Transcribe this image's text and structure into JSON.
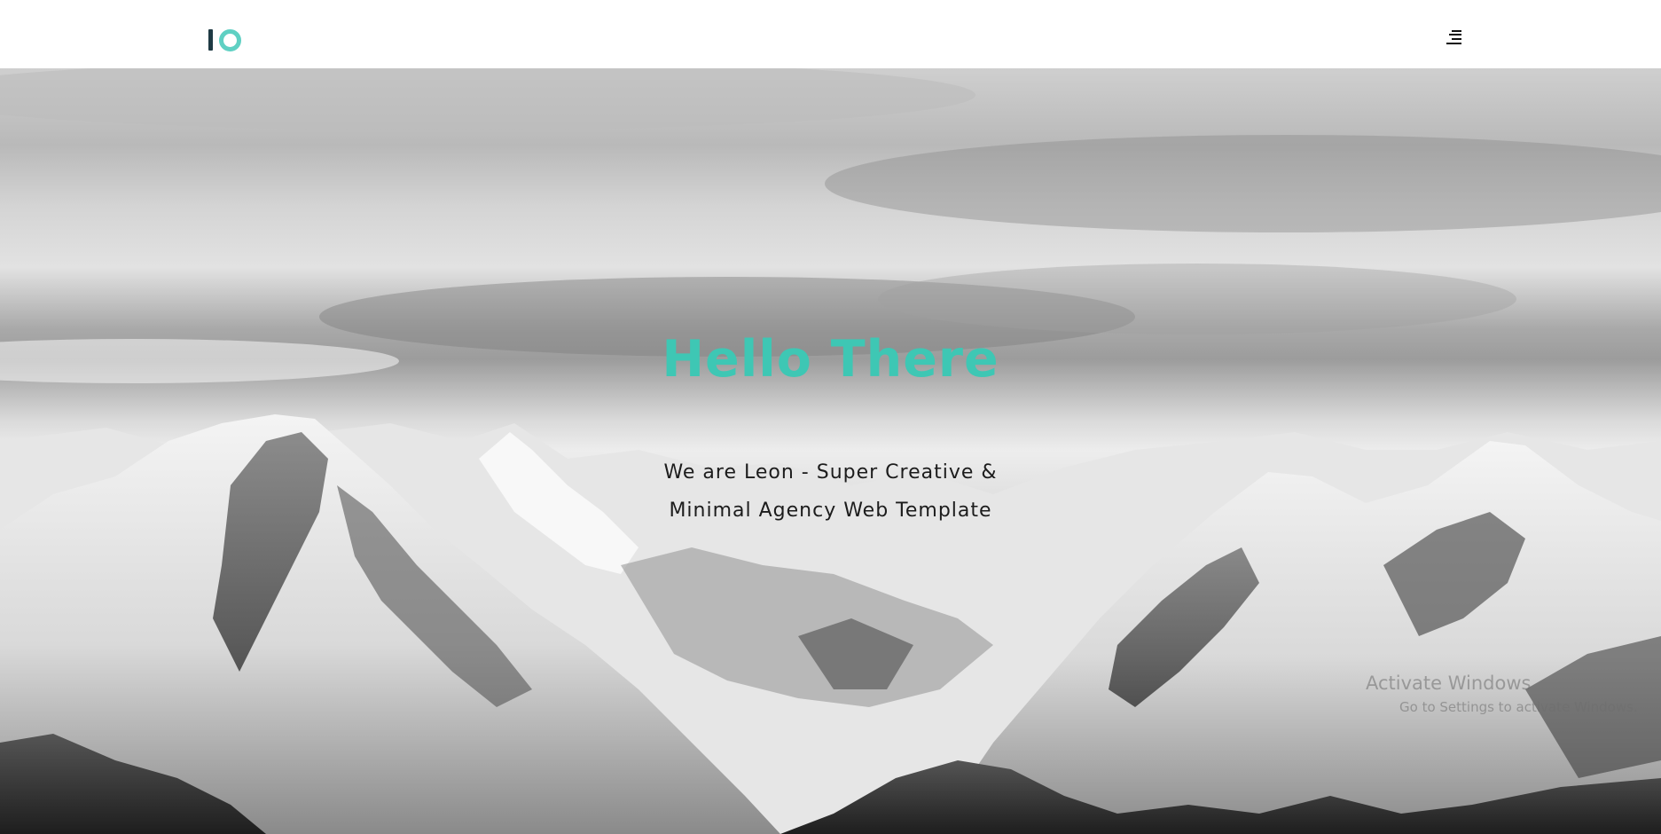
{
  "header": {
    "logo_icon": "io-logo-icon",
    "menu_icon": "hamburger-menu-icon"
  },
  "hero": {
    "title": "Hello There",
    "subtitle_line1": "We are Leon - Super Creative &",
    "subtitle_line2": "Minimal Agency Web Template",
    "title_color": "#3ec7b4",
    "background": "snowy-mountains-monochrome"
  },
  "watermark": {
    "line1": "Activate Windows",
    "line2": "Go to Settings to activate Windows."
  },
  "colors": {
    "accent": "#3ec7b4",
    "logo_dark": "#1f3a44",
    "logo_ring": "#5fd0c3"
  }
}
